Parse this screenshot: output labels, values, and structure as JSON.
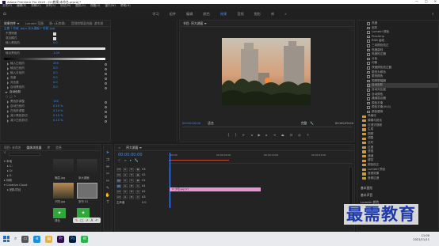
{
  "window": {
    "title": "Adobe Premiere Pro 2020 - D:\\教案\\未命名.prproj *"
  },
  "menu": [
    "文件(F)",
    "编辑(E)",
    "剪辑(C)",
    "序列(S)",
    "标记(M)",
    "图形(G)",
    "视图(V)",
    "窗口(W)",
    "帮助(H)"
  ],
  "workspaces": {
    "items": [
      "学习",
      "组件",
      "编辑",
      "颜色",
      "效果",
      "音频",
      "图形",
      "库"
    ],
    "active_index": 5
  },
  "effect_controls": {
    "tabs": [
      "效果控件 ≡",
      "Lumetri 范围",
      "源: (无剪辑)",
      "音频剪辑混合器: 游木湖"
    ],
    "source_line": "主要 * 坊城 .jpg  ▸  序大湖面 * 坊城 .jpg",
    "rows": [
      {
        "label": "不透明度",
        "value": ""
      },
      {
        "label": "混合模式",
        "value": ""
      },
      {
        "label": "输入黑色阶",
        "value": "0.0"
      },
      {
        "label": "输出黑色阶",
        "value": "1.00"
      },
      {
        "label": "输入白色阶",
        "value": "255"
      },
      {
        "label": "输出白色阶",
        "value": "0.0"
      },
      {
        "label": "输入灰色阶",
        "value": "0.0"
      },
      {
        "label": "亮度",
        "value": "0.0"
      },
      {
        "label": "对比度",
        "value": "0.0"
      },
      {
        "label": "自动黑色阶",
        "value": "0.0"
      },
      {
        "label": "黑色阶调整",
        "value": "0.0"
      },
      {
        "label": "自动白色阶",
        "value": "0.10 %"
      },
      {
        "label": "白色阶调整",
        "value": "0.10 %"
      },
      {
        "label": "减少黑色剪切",
        "value": "0.10 %"
      },
      {
        "label": "减少白色剪切",
        "value": "0.10 %"
      }
    ],
    "section": "自动色阶",
    "section_value": "100"
  },
  "program": {
    "tab": "节目: 序大湖面 ≡",
    "timecode_left": "00:00:00:00",
    "fit": "适合",
    "quality": "完整",
    "timecode_right": "00:00:05:00"
  },
  "project": {
    "tabs": [
      "项目: 未命名",
      "媒体浏览器",
      "库",
      "信息"
    ],
    "search_placeholder": "",
    "bins": [
      "本地",
      "网络",
      "Creative Cloud",
      "团队项目"
    ],
    "items": [
      {
        "label": "晚霞.jpg"
      },
      {
        "label": "序大湖面"
      },
      {
        "label": "夕阳.jpg"
      },
      {
        "label": "序列 01"
      },
      {
        "label": "绿色"
      },
      {
        "label": "抠像"
      }
    ]
  },
  "effects": {
    "rows": [
      "亮度",
      "色阶",
      "Lumetri 颜色",
      "ProcAmp",
      "RGB 曲线",
      "三向颜色校正",
      "亮度曲线",
      "亮度校正器",
      "分色",
      "均衡",
      "快速颜色校正器",
      "更改为颜色",
      "更改颜色",
      "视频限幅器",
      "自动色阶",
      "自动对比度",
      "自动颜色",
      "通道混合器",
      "颜色平衡",
      "颜色平衡(HLS)",
      "颜色替换",
      "风格化",
      "模糊与锐化",
      "沉浸式视频",
      "生成",
      "视频",
      "调整",
      "过时",
      "过渡",
      "透视",
      "通道",
      "键控",
      "颜色校正",
      "Lumetri 预设",
      "音频效果",
      "音频过渡"
    ],
    "bottom": [
      "基本图形",
      "基本声音",
      "Lumetri 颜色",
      "标记",
      "历史记录"
    ]
  },
  "timeline": {
    "tab": "序大湖面 ≡",
    "timecode": "00:00:00:00",
    "tracks": [
      "V3",
      "V2",
      "V1",
      "A1",
      "A2",
      "A3",
      "主声道"
    ],
    "clip_label": "fx 夕阳.jpg [V]",
    "ruler": [
      "00:00",
      "00:00:05:00",
      "00:00:10:00",
      "00:00:15:00"
    ]
  },
  "taskbar": {
    "time": "11:00",
    "date": "2021/11/11",
    "search_label": "搜索"
  },
  "watermark": "最需教育",
  "colors": {
    "accent": "#3f8ef0",
    "clip": "#e497d4",
    "playhead": "#4a8cff",
    "workarea": "#c24a3a"
  }
}
